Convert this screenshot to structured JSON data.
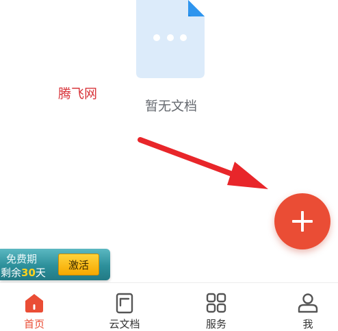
{
  "empty_state": {
    "text": "暂无文档",
    "icon": "document-more-icon"
  },
  "watermark": {
    "text": "腾飞网"
  },
  "fab": {
    "icon": "plus-icon",
    "color": "#ea4d35"
  },
  "trial_banner": {
    "line1": "免费期",
    "prefix": "剩余",
    "days": "30",
    "suffix": "天",
    "button_label": "激活"
  },
  "bottom_nav": {
    "active_color": "#ea4d35",
    "items": [
      {
        "label": "首页",
        "icon": "home-icon",
        "active": true
      },
      {
        "label": "云文档",
        "icon": "cloud-doc-icon",
        "active": false
      },
      {
        "label": "服务",
        "icon": "grid-icon",
        "active": false
      },
      {
        "label": "我",
        "icon": "user-icon",
        "active": false
      }
    ]
  }
}
